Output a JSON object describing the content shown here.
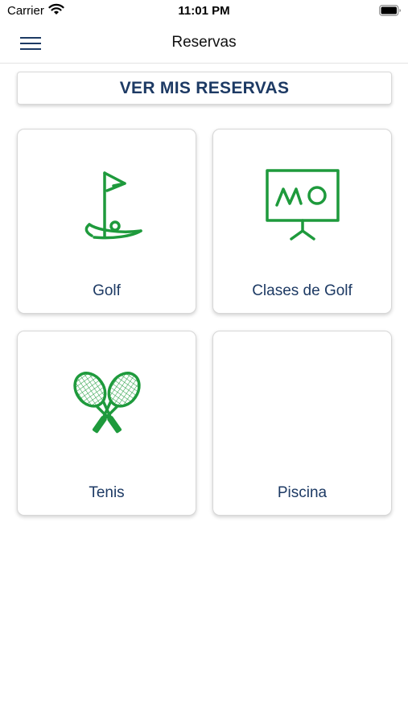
{
  "status_bar": {
    "carrier": "Carrier",
    "time": "11:01 PM"
  },
  "nav": {
    "title": "Reservas",
    "menu_icon": "hamburger-menu-icon"
  },
  "my_bookings_button": "VER MIS RESERVAS",
  "cards": [
    {
      "label": "Golf",
      "icon": "golf-flag-icon"
    },
    {
      "label": "Clases de Golf",
      "icon": "whiteboard-icon"
    },
    {
      "label": "Tenis",
      "icon": "tennis-rackets-icon"
    },
    {
      "label": "Piscina",
      "icon": ""
    }
  ],
  "colors": {
    "accent_text": "#1d3a64",
    "icon_green": "#1e9a3c"
  }
}
